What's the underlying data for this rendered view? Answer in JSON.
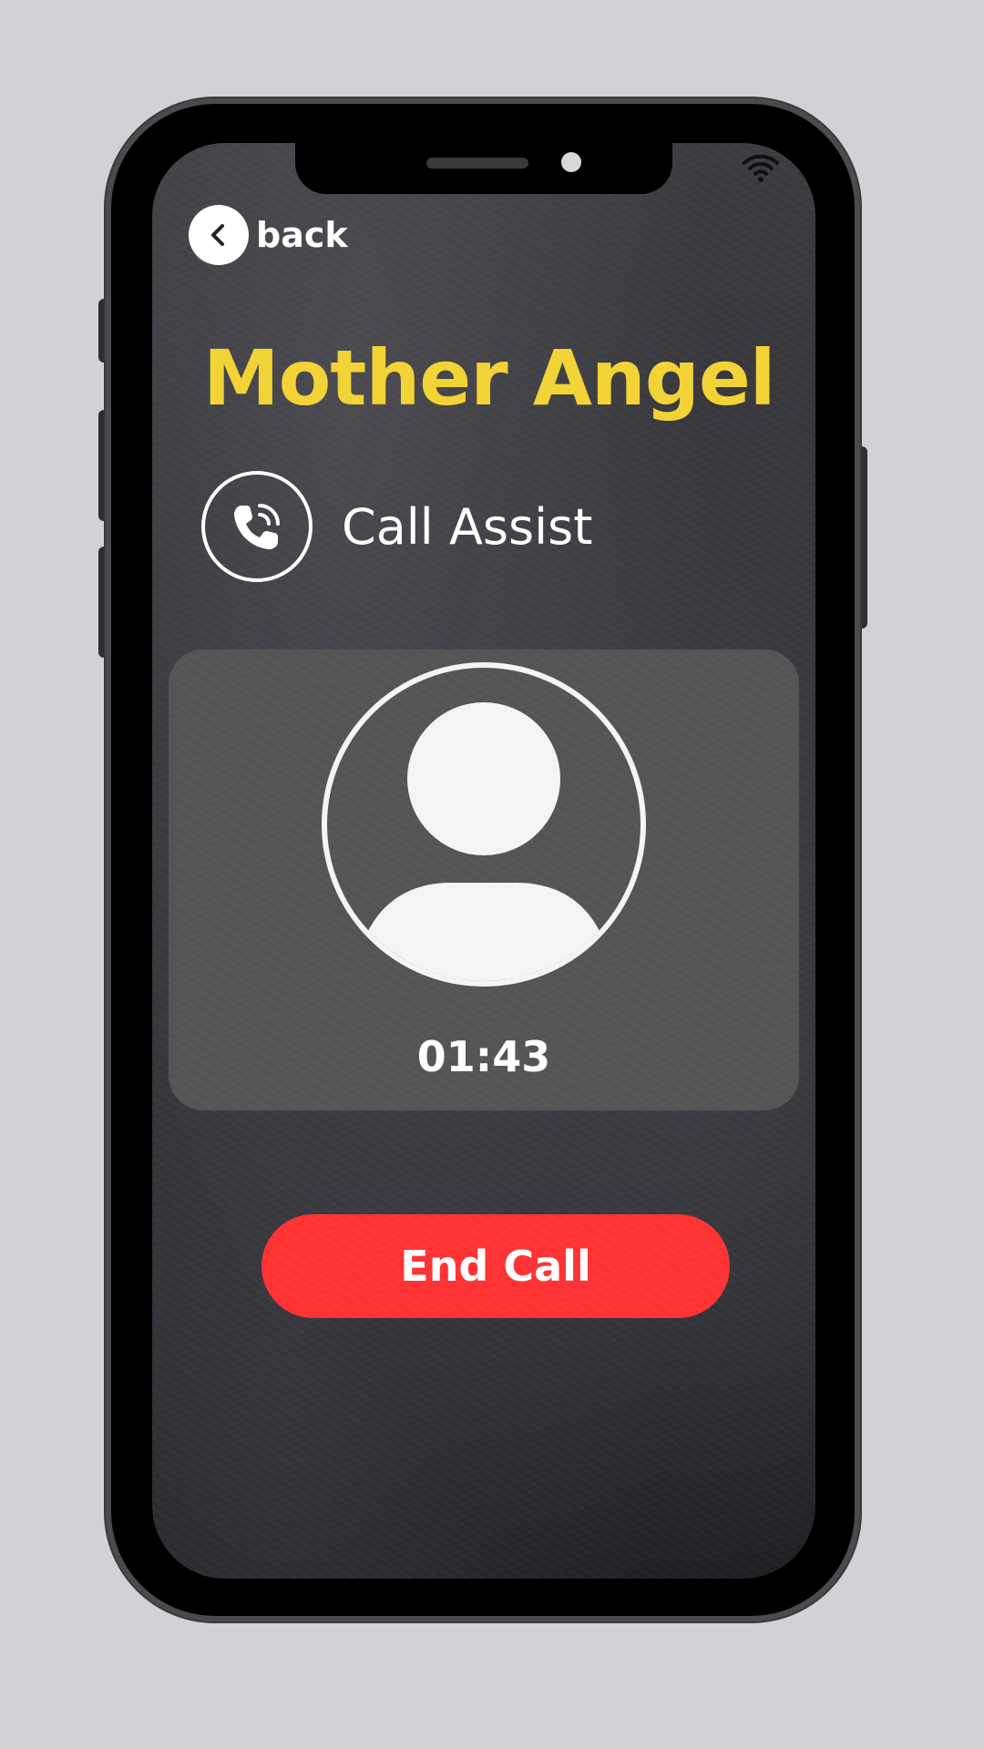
{
  "colors": {
    "background": "#d1d2d6",
    "name_accent": "#f2d335",
    "end_call": "#fe3233",
    "card": "#545454"
  },
  "nav": {
    "back_label": "back",
    "back_icon": "chevron-left-icon"
  },
  "status_bar": {
    "wifi_icon": "wifi-icon"
  },
  "contact": {
    "name": "Mother Angel",
    "avatar_icon": "user-avatar-icon"
  },
  "assist": {
    "icon": "phone-ringing-icon",
    "label": "Call Assist"
  },
  "call": {
    "duration": "01:43",
    "end_label": "End Call"
  }
}
